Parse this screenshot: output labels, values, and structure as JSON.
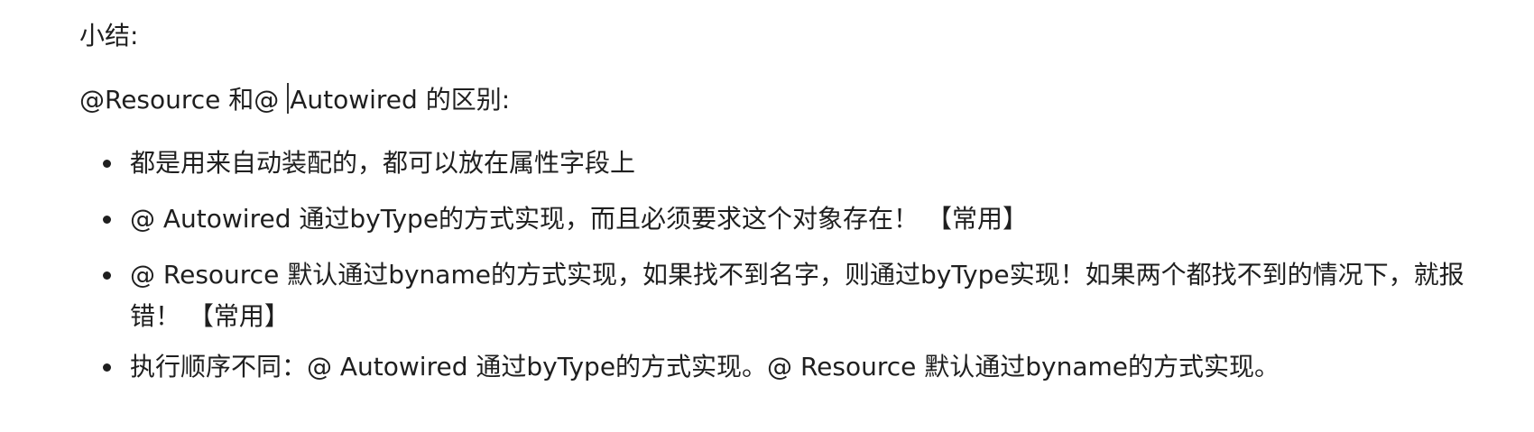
{
  "summary_title": "小结:",
  "heading": {
    "before_cursor": "@Resource 和@ ",
    "after_cursor": "Autowired 的区别:"
  },
  "bullets": [
    "都是用来自动装配的，都可以放在属性字段上",
    "@ Autowired  通过byType的方式实现，而且必须要求这个对象存在！  【常用】",
    "@ Resource 默认通过byname的方式实现，如果找不到名字，则通过byType实现！如果两个都找不到的情况下，就报错！  【常用】",
    "执行顺序不同：@ Autowired  通过byType的方式实现。@ Resource 默认通过byname的方式实现。"
  ]
}
